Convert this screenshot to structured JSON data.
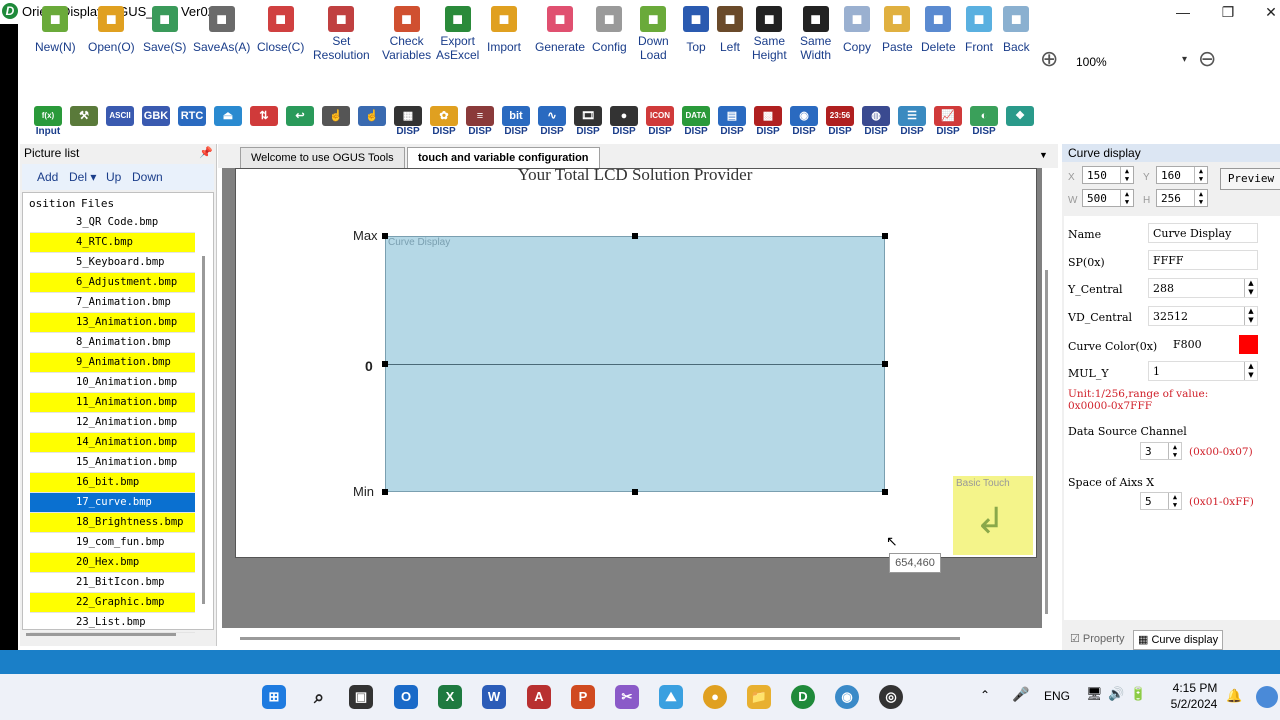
{
  "window": {
    "title": "Orient Display(OGUS_Tool Ver02)",
    "logo": "D",
    "minimize": "—",
    "maximize": "❐",
    "close": "✕"
  },
  "toolbar1": [
    {
      "label": "New(N)",
      "icon": "new-icon",
      "color": "#6aaa3a"
    },
    {
      "label": "Open(O)",
      "icon": "open-folder-icon",
      "color": "#e0a020"
    },
    {
      "label": "Save(S)",
      "icon": "save-icon",
      "color": "#3a9a5a"
    },
    {
      "label": "SaveAs(A)",
      "icon": "save-as-icon",
      "color": "#6a6a6a"
    },
    {
      "label": "Close(C)",
      "icon": "close-file-icon",
      "color": "#d04040"
    },
    {
      "label": "Set\nResolution",
      "icon": "resolution-icon",
      "color": "#c04040"
    },
    {
      "label": "Check\nVariables",
      "icon": "check-variables-icon",
      "color": "#d05030"
    },
    {
      "label": "Export\nAsExcel",
      "icon": "excel-icon",
      "color": "#2a8a3a"
    },
    {
      "label": "Import",
      "icon": "import-icon",
      "color": "#e0a020"
    },
    {
      "label": "Generate",
      "icon": "generate-icon",
      "color": "#e05070"
    },
    {
      "label": "Config",
      "icon": "config-gear-icon",
      "color": "#9a9a9a"
    },
    {
      "label": "Down\nLoad",
      "icon": "download-icon",
      "color": "#6aaa3a"
    },
    {
      "label": "Top",
      "icon": "align-top-icon",
      "color": "#2a5ab0"
    },
    {
      "label": "Left",
      "icon": "align-left-icon",
      "color": "#6a4a2a"
    },
    {
      "label": "Same\nHeight",
      "icon": "same-height-icon",
      "color": "#222222"
    },
    {
      "label": "Same\nWidth",
      "icon": "same-width-icon",
      "color": "#222222"
    },
    {
      "label": "Copy",
      "icon": "copy-icon",
      "color": "#9ab0d0"
    },
    {
      "label": "Paste",
      "icon": "paste-icon",
      "color": "#e0b040"
    },
    {
      "label": "Delete",
      "icon": "delete-icon",
      "color": "#5a8ad0"
    },
    {
      "label": "Front",
      "icon": "bring-front-icon",
      "color": "#5ab0e0"
    },
    {
      "label": "Back",
      "icon": "send-back-icon",
      "color": "#8ab0d0"
    }
  ],
  "zoom": {
    "level": "100%"
  },
  "toolbar2": [
    {
      "glyph": "f(x)",
      "label": "Input",
      "color": "#2a9a3a"
    },
    {
      "glyph": "⚒",
      "label": "",
      "color": "#5a7a3a"
    },
    {
      "glyph": "ASCII",
      "label": "",
      "color": "#3a5ab0"
    },
    {
      "glyph": "GBK",
      "label": "",
      "color": "#3a5ab0"
    },
    {
      "glyph": "RTC",
      "label": "",
      "color": "#2a6ac0"
    },
    {
      "glyph": "⏏",
      "label": "",
      "color": "#2a8ad0"
    },
    {
      "glyph": "⇅",
      "label": "",
      "color": "#d03a3a"
    },
    {
      "glyph": "↩",
      "label": "",
      "color": "#2a9a5a"
    },
    {
      "glyph": "☝",
      "label": "",
      "color": "#555555"
    },
    {
      "glyph": "☝",
      "label": "",
      "color": "#3a6ab0"
    },
    {
      "glyph": "▦",
      "label": "DISP",
      "color": "#333333"
    },
    {
      "glyph": "✿",
      "label": "DISP",
      "color": "#e0a020"
    },
    {
      "glyph": "≡",
      "label": "DISP",
      "color": "#8a3a3a"
    },
    {
      "glyph": "bit",
      "label": "DISP",
      "color": "#2a6ac0"
    },
    {
      "glyph": "∿",
      "label": "DISP",
      "color": "#2a6ac0"
    },
    {
      "glyph": "🎞",
      "label": "DISP",
      "color": "#333333"
    },
    {
      "glyph": "●",
      "label": "DISP",
      "color": "#333333"
    },
    {
      "glyph": "ICON",
      "label": "DISP",
      "color": "#d03a3a"
    },
    {
      "glyph": "DATA",
      "label": "DISP",
      "color": "#2a9a3a"
    },
    {
      "glyph": "▤",
      "label": "DISP",
      "color": "#2a6ac0"
    },
    {
      "glyph": "▩",
      "label": "DISP",
      "color": "#b02020"
    },
    {
      "glyph": "◉",
      "label": "DISP",
      "color": "#2a6ac0"
    },
    {
      "glyph": "23:56",
      "label": "DISP",
      "color": "#b02020"
    },
    {
      "glyph": "◍",
      "label": "DISP",
      "color": "#3a4a90"
    },
    {
      "glyph": "☰",
      "label": "DISP",
      "color": "#3a8ac0"
    },
    {
      "glyph": "📈",
      "label": "DISP",
      "color": "#d03a3a"
    },
    {
      "glyph": "◐",
      "label": "DISP",
      "color": "#3aa05a"
    },
    {
      "glyph": "❖",
      "label": "",
      "color": "#2a9a8a"
    }
  ],
  "picture_list": {
    "title": "Picture list",
    "toolbar": {
      "add": "Add",
      "del": "Del ▾",
      "up": "Up",
      "down": "Down"
    },
    "header": {
      "position": "osition",
      "files": "Files"
    },
    "rows": [
      {
        "file": "3_QR Code.bmp",
        "state": "normal"
      },
      {
        "file": "4_RTC.bmp",
        "state": "yellow"
      },
      {
        "file": "5_Keyboard.bmp",
        "state": "normal"
      },
      {
        "file": "6_Adjustment.bmp",
        "state": "yellow"
      },
      {
        "file": "7_Animation.bmp",
        "state": "normal"
      },
      {
        "file": "13_Animation.bmp",
        "state": "yellow"
      },
      {
        "file": "8_Animation.bmp",
        "state": "normal"
      },
      {
        "file": "9_Animation.bmp",
        "state": "yellow"
      },
      {
        "file": "10_Animation.bmp",
        "state": "normal"
      },
      {
        "file": "11_Animation.bmp",
        "state": "yellow"
      },
      {
        "file": "12_Animation.bmp",
        "state": "normal"
      },
      {
        "file": "14_Animation.bmp",
        "state": "yellow"
      },
      {
        "file": "15_Animation.bmp",
        "state": "normal"
      },
      {
        "file": "16_bit.bmp",
        "state": "yellow"
      },
      {
        "file": "17_curve.bmp",
        "state": "selected"
      },
      {
        "file": "18_Brightness.bmp",
        "state": "yellow"
      },
      {
        "file": "19_com_fun.bmp",
        "state": "normal"
      },
      {
        "file": "20_Hex.bmp",
        "state": "yellow"
      },
      {
        "file": "21_BitIcon.bmp",
        "state": "normal"
      },
      {
        "file": "22_Graphic.bmp",
        "state": "yellow"
      },
      {
        "file": "23_List.bmp",
        "state": "normal"
      }
    ]
  },
  "tabs": [
    {
      "label": "Welcome to use OGUS Tools",
      "active": false
    },
    {
      "label": "touch and variable configuration",
      "active": true
    }
  ],
  "canvas": {
    "header_text": "Your Total LCD Solution Provider",
    "curve_label": "Curve Display",
    "axis_max": "Max",
    "axis_zero": "0",
    "axis_min": "Min",
    "basic_touch": "Basic Touch",
    "coord_tooltip": "654,460"
  },
  "curve_panel": {
    "title": "Curve display",
    "x": "150",
    "y": "160",
    "w": "500",
    "h": "256",
    "preview": "Preview",
    "name_label": "Name",
    "name_value": "Curve Display",
    "sp_label": "SP(0x)",
    "sp_value": "FFFF",
    "ycentral_label": "Y_Central",
    "ycentral_value": "288",
    "vdcentral_label": "VD_Central",
    "vdcentral_value": "32512",
    "color_label": "Curve Color(0x)",
    "color_value": "F800",
    "swatch": "#ff0000",
    "muly_label": "MUL_Y",
    "muly_value": "1",
    "unit_note1": "Unit:1/256,range of value:",
    "unit_note2": "0x0000-0x7FFF",
    "channel_label": "Data Source Channel",
    "channel_value": "3",
    "channel_range": "(0x00-0x07)",
    "spacex_label": "Space of Aixs X",
    "spacex_value": "5",
    "spacex_range": "(0x01-0xFF)"
  },
  "right_tabs": [
    {
      "label": "Property"
    },
    {
      "label": "Curve display"
    }
  ],
  "taskbar": {
    "language": "ENG",
    "time": "4:15 PM",
    "date": "5/2/2024"
  }
}
